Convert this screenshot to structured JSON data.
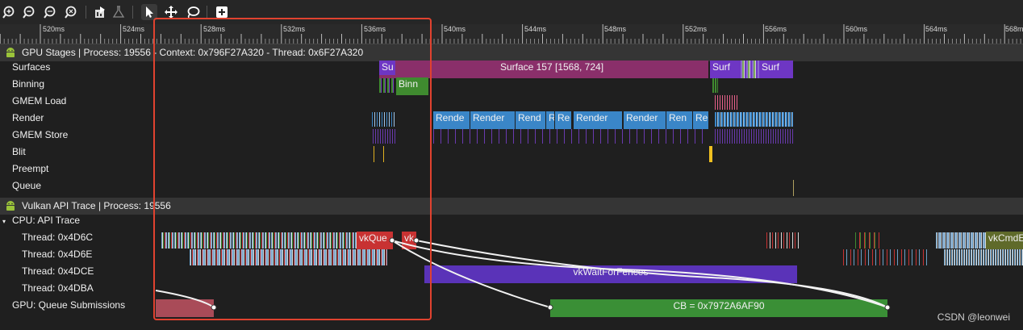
{
  "toolbar": {
    "buttons": [
      {
        "icon": "zoom-in-icon",
        "glyph": "+"
      },
      {
        "icon": "zoom-out-icon",
        "glyph": "−"
      },
      {
        "icon": "zoom-fit-icon",
        "glyph": "⋯"
      },
      {
        "icon": "zoom-reset-icon",
        "glyph": "↺"
      },
      {
        "icon": "share-icon",
        "glyph": ""
      },
      {
        "icon": "flask-icon",
        "glyph": ""
      },
      {
        "icon": "select-pointer-icon",
        "glyph": ""
      },
      {
        "icon": "pan-move-icon",
        "glyph": ""
      },
      {
        "icon": "lasso-icon",
        "glyph": ""
      },
      {
        "icon": "add-track-icon",
        "glyph": "+"
      }
    ]
  },
  "ruler": {
    "ticks": [
      "520ms",
      "524ms",
      "528ms",
      "532ms",
      "536ms",
      "540ms",
      "544ms",
      "548ms",
      "552ms",
      "556ms",
      "560ms",
      "564ms",
      "568ms"
    ]
  },
  "gpu_stages": {
    "title": "GPU Stages | Process: 19556 - Context: 0x796F27A320 - Thread: 0x6F27A320",
    "rows": [
      "Surfaces",
      "Binning",
      "GMEM Load",
      "Render",
      "GMEM Store",
      "Blit",
      "Preempt",
      "Queue"
    ],
    "bars": {
      "surface_small": "Su",
      "surface_main": "Surface 157 [1568, 724]",
      "surface_b": "Surf",
      "surface_c": "Surf",
      "binning": "Binn",
      "render": [
        "Rende",
        "Render",
        "Rend",
        "R",
        "Re",
        "Render",
        "Render",
        "Ren",
        "Re"
      ]
    }
  },
  "vulkan": {
    "title": "Vulkan API Trace | Process: 19556",
    "cpu_group": "CPU: API Trace",
    "threads": [
      "Thread: 0x4D6C",
      "Thread: 0x4D6E",
      "Thread: 0x4DCE",
      "Thread: 0x4DBA"
    ],
    "gpu_row": "GPU: Queue Submissions",
    "bars": {
      "vkque": "vkQue",
      "vk": "vk",
      "vkcmd": "vkCmdE",
      "waitfences": "vkWaitForFences",
      "cb": "CB = 0x7972A6AF90"
    }
  },
  "watermark": "CSDN @leonwei",
  "colors": {
    "surface": "#8a2f6a",
    "surface_purple": "#6e36c4",
    "binning": "#3f8a2f",
    "render": "#3a86c8",
    "vkque": "#c83232",
    "wait": "#5a33b8",
    "cb": "#3a8f36",
    "selection": "#e0422f"
  }
}
